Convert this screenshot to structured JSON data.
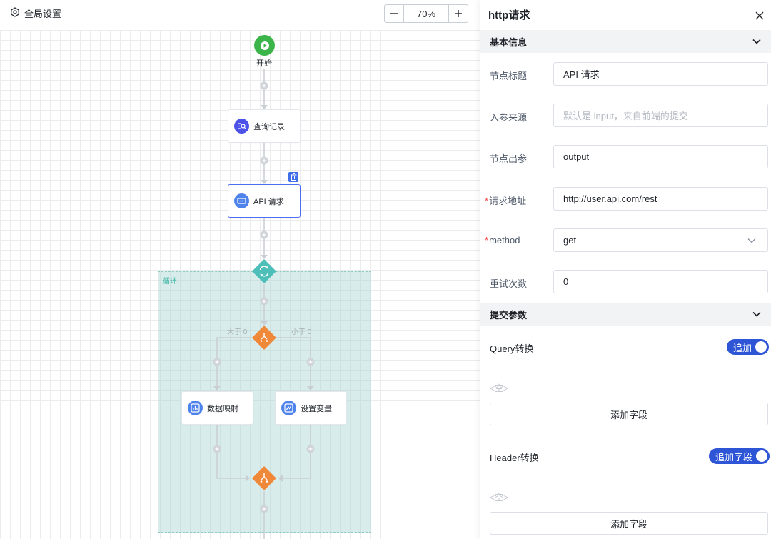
{
  "toolbar": {
    "global_settings_label": "全局设置",
    "zoom_level": "70%"
  },
  "flow": {
    "start_label": "开始",
    "nodes": {
      "query_records": "查询记录",
      "api_request": "API 请求",
      "data_mapping": "数据映射",
      "set_variable": "设置变量"
    },
    "loop_label": "循环",
    "branch_labels": {
      "greater": "大于 0",
      "less": "小于 0"
    }
  },
  "panel": {
    "title": "http请求",
    "basic_section_title": "基本信息",
    "fields": {
      "node_title": {
        "label": "节点标题",
        "value": "API 请求"
      },
      "input_source": {
        "label": "入参来源",
        "placeholder": "默认是 input，来自前端的提交"
      },
      "node_output": {
        "label": "节点出参",
        "value": "output"
      },
      "request_url": {
        "label": "请求地址",
        "value": "http://user.api.com/rest",
        "required": true
      },
      "method": {
        "label": "method",
        "value": "get",
        "required": true
      },
      "retry_count": {
        "label": "重试次数",
        "value": "0"
      }
    },
    "submit_section_title": "提交参数",
    "query_transform": {
      "label": "Query转换",
      "toggle_label": "追加",
      "enabled": true
    },
    "header_transform": {
      "label": "Header转换",
      "toggle_label": "追加字段",
      "enabled": true
    },
    "empty_text": "<空>",
    "add_field_label": "添加字段"
  },
  "colors": {
    "start_green": "#3bb54a",
    "loop_teal": "#4dbfb8",
    "branch_orange": "#f0883a",
    "node_purple": "#4c52e8",
    "node_blue": "#4e83ec",
    "toggle_blue": "#2d55d6",
    "required_red": "#f53f3f"
  }
}
